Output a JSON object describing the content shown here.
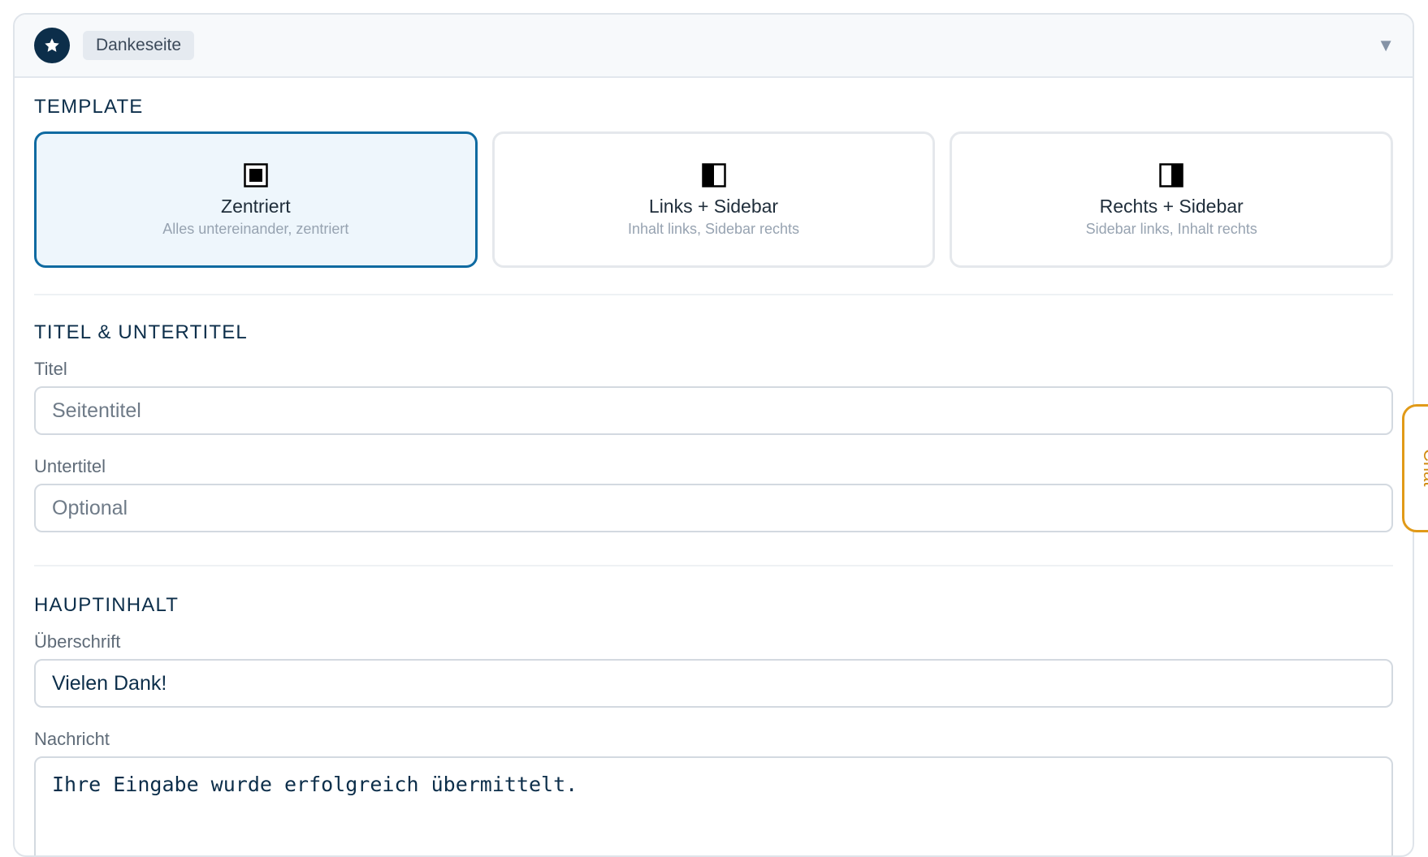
{
  "header": {
    "icon": "star-icon",
    "badge": "Dankeseite",
    "toggle_icon": "chevron-down-icon"
  },
  "template": {
    "title": "TEMPLATE",
    "options": [
      {
        "title": "Zentriert",
        "subtitle": "Alles untereinander, zentriert",
        "icon": "layout-centered-icon",
        "selected": true
      },
      {
        "title": "Links + Sidebar",
        "subtitle": "Inhalt links, Sidebar rechts",
        "icon": "layout-left-sidebar-icon",
        "selected": false
      },
      {
        "title": "Rechts + Sidebar",
        "subtitle": "Sidebar links, Inhalt rechts",
        "icon": "layout-right-sidebar-icon",
        "selected": false
      }
    ]
  },
  "titles": {
    "title": "TITEL & UNTERTITEL",
    "titel": {
      "label": "Titel",
      "value": "",
      "placeholder": "Seitentitel"
    },
    "untertitel": {
      "label": "Untertitel",
      "value": "",
      "placeholder": "Optional"
    }
  },
  "main": {
    "title": "HAUPTINHALT",
    "heading": {
      "label": "Überschrift",
      "value": "Vielen Dank!"
    },
    "message": {
      "label": "Nachricht",
      "value": "Ihre Eingabe wurde erfolgreich übermittelt."
    }
  },
  "side_tab": {
    "label": "Chat"
  },
  "colors": {
    "accent": "#0e6aa1",
    "primary": "#0c2e4a",
    "side_tab": "#e19a18"
  }
}
